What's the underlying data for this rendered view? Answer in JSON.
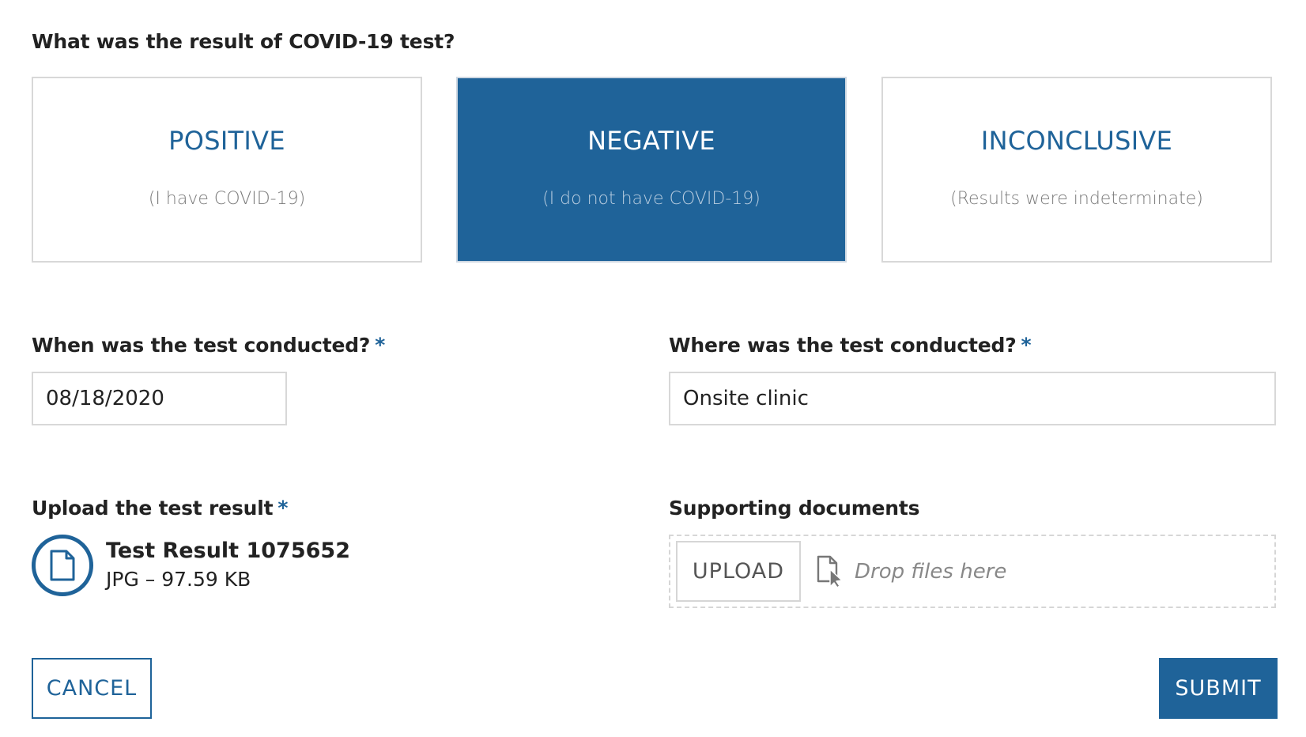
{
  "question": {
    "title": "What was the result of COVID-19 test?"
  },
  "result_options": [
    {
      "id": "positive",
      "label": "POSITIVE",
      "description": "(I have COVID-19)",
      "selected": false
    },
    {
      "id": "negative",
      "label": "NEGATIVE",
      "description": "(I do not have COVID-19)",
      "selected": true
    },
    {
      "id": "inconclusive",
      "label": "INCONCLUSIVE",
      "description": "(Results were indeterminate)",
      "selected": false
    }
  ],
  "when_field": {
    "label": "When was the test conducted?",
    "required_marker": "*",
    "value": "08/18/2020"
  },
  "where_field": {
    "label": "Where was the test conducted?",
    "required_marker": "*",
    "value": "Onsite clinic"
  },
  "upload_result": {
    "label": "Upload the test result",
    "required_marker": "*",
    "file": {
      "icon": "file-icon",
      "name": "Test Result 1075652",
      "info": "JPG – 97.59 KB"
    }
  },
  "supporting_documents": {
    "label": "Supporting documents",
    "upload_button": "UPLOAD",
    "drop_icon": "file-drag-icon",
    "drop_text": "Drop files here"
  },
  "actions": {
    "cancel": "CANCEL",
    "submit": "SUBMIT"
  },
  "colors": {
    "accent": "#1f6399",
    "border": "#d8d8d8",
    "text": "#222222",
    "muted": "#7a7a7a"
  }
}
